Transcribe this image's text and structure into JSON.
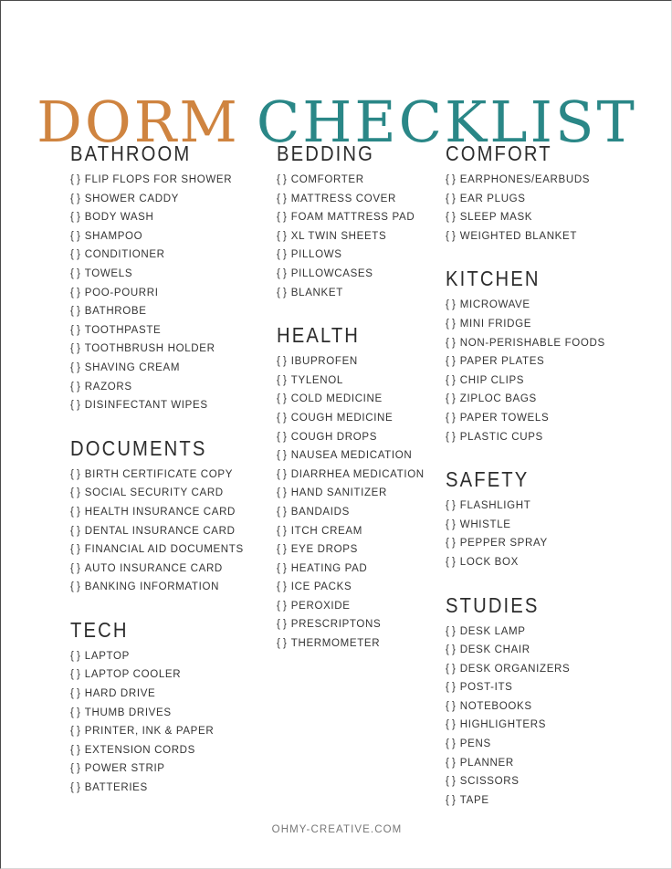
{
  "title": {
    "word_1": "DORM",
    "word_2": "CHECKLIST",
    "color_1": "#cf8440",
    "color_2": "#2a8787"
  },
  "checkbox_marker": "{ }",
  "footer": {
    "text": "OHMY-CREATIVE.COM"
  },
  "columns": [
    {
      "sections": [
        {
          "title": "BATHROOM",
          "items": [
            "FLIP FLOPS FOR SHOWER",
            "SHOWER CADDY",
            "BODY WASH",
            "SHAMPOO",
            "CONDITIONER",
            "TOWELS",
            "POO-POURRI",
            "BATHROBE",
            "TOOTHPASTE",
            "TOOTHBRUSH HOLDER",
            "SHAVING CREAM",
            "RAZORS",
            "DISINFECTANT WIPES"
          ]
        },
        {
          "title": "DOCUMENTS",
          "items": [
            "BIRTH CERTIFICATE COPY",
            "SOCIAL SECURITY CARD",
            "HEALTH INSURANCE CARD",
            "DENTAL INSURANCE CARD",
            "FINANCIAL AID DOCUMENTS",
            "AUTO INSURANCE CARD",
            "BANKING INFORMATION"
          ]
        },
        {
          "title": "TECH",
          "items": [
            "LAPTOP",
            "LAPTOP COOLER",
            "HARD DRIVE",
            "THUMB DRIVES",
            "PRINTER, INK & PAPER",
            "EXTENSION CORDS",
            "POWER STRIP",
            "BATTERIES"
          ]
        }
      ]
    },
    {
      "sections": [
        {
          "title": "BEDDING",
          "items": [
            "COMFORTER",
            "MATTRESS COVER",
            "FOAM MATTRESS PAD",
            "XL TWIN SHEETS",
            "PILLOWS",
            "PILLOWCASES",
            "BLANKET"
          ]
        },
        {
          "title": "HEALTH",
          "items": [
            "IBUPROFEN",
            "TYLENOL",
            "COLD MEDICINE",
            "COUGH MEDICINE",
            "COUGH DROPS",
            "NAUSEA MEDICATION",
            "DIARRHEA MEDICATION",
            "HAND SANITIZER",
            "BANDAIDS",
            "ITCH CREAM",
            "EYE DROPS",
            "HEATING PAD",
            "ICE PACKS",
            "PEROXIDE",
            "PRESCRIPTONS",
            "THERMOMETER"
          ]
        }
      ]
    },
    {
      "sections": [
        {
          "title": "COMFORT",
          "items": [
            "EARPHONES/EARBUDS",
            "EAR PLUGS",
            "SLEEP MASK",
            "WEIGHTED BLANKET"
          ]
        },
        {
          "title": "KITCHEN",
          "items": [
            "MICROWAVE",
            "MINI FRIDGE",
            "NON-PERISHABLE FOODS",
            "PAPER PLATES",
            "CHIP CLIPS",
            "ZIPLOC BAGS",
            "PAPER TOWELS",
            "PLASTIC CUPS"
          ]
        },
        {
          "title": "SAFETY",
          "items": [
            "FLASHLIGHT",
            "WHISTLE",
            "PEPPER SPRAY",
            "LOCK BOX"
          ]
        },
        {
          "title": "STUDIES",
          "items": [
            "DESK LAMP",
            "DESK CHAIR",
            "DESK ORGANIZERS",
            "POST-ITS",
            "NOTEBOOKS",
            "HIGHLIGHTERS",
            "PENS",
            "PLANNER",
            "SCISSORS",
            "TAPE"
          ]
        }
      ]
    }
  ]
}
